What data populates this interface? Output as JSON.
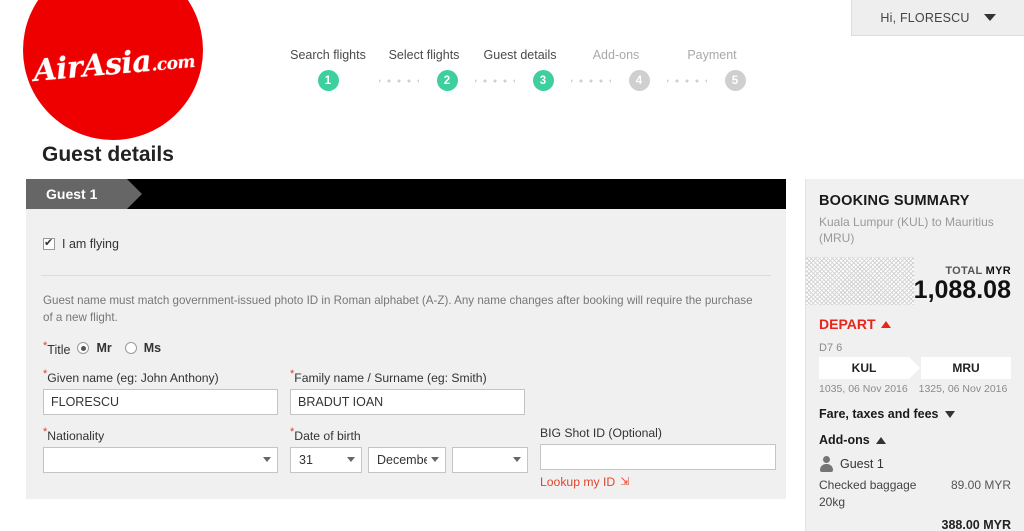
{
  "header": {
    "user_greeting": "Hi, FLORESCU",
    "logo_text": "AirAsia",
    "logo_suffix": ".com"
  },
  "stepper": {
    "steps": [
      {
        "label": "Search flights",
        "number": "1",
        "state": "done"
      },
      {
        "label": "Select flights",
        "number": "2",
        "state": "done"
      },
      {
        "label": "Guest details",
        "number": "3",
        "state": "done"
      },
      {
        "label": "Add-ons",
        "number": "4",
        "state": "todo"
      },
      {
        "label": "Payment",
        "number": "5",
        "state": "todo"
      }
    ],
    "accent_done": "#3ecf9e",
    "accent_todo": "#cfcfcf"
  },
  "page": {
    "title": "Guest details"
  },
  "form": {
    "guest_tab_label": "Guest 1",
    "i_am_flying_label": "I am flying",
    "notice": "Guest name must match government-issued photo ID in Roman alphabet (A-Z). Any name changes after booking will require the purchase of a new flight.",
    "title_field": {
      "label": "Title",
      "options": [
        "Mr",
        "Ms"
      ],
      "selected": "Mr"
    },
    "given_name": {
      "label": "Given name (eg: John Anthony)",
      "value": "FLORESCU"
    },
    "family_name": {
      "label": "Family name / Surname (eg: Smith)",
      "value": "BRADUT IOAN"
    },
    "nationality": {
      "label": "Nationality",
      "value": ""
    },
    "date_of_birth": {
      "label": "Date of birth",
      "day": "31",
      "month": "December",
      "year": ""
    },
    "big_shot_id": {
      "label": "BIG Shot ID (Optional)",
      "value": "",
      "lookup_label": "Lookup my ID",
      "lookup_color": "#e0462f"
    }
  },
  "summary": {
    "title": "BOOKING SUMMARY",
    "route_description": "Kuala Lumpur (KUL) to Mauritius (MRU)",
    "total_label": "TOTAL",
    "total_currency": "MYR",
    "total_amount": "1,088.08",
    "depart_label": "DEPART",
    "depart_color": "#e8251b",
    "flight_number": "D7 6",
    "origin_code": "KUL",
    "destination_code": "MRU",
    "depart_time": "1035, 06 Nov 2016",
    "arrive_time": "1325, 06 Nov 2016",
    "fare_section_label": "Fare, taxes and fees",
    "addons_section_label": "Add-ons",
    "addons_guest_label": "Guest 1",
    "addon_item_name": "Checked baggage 20kg",
    "addon_item_price": "89.00 MYR",
    "cut_off_amount": "388.00 MYR"
  }
}
